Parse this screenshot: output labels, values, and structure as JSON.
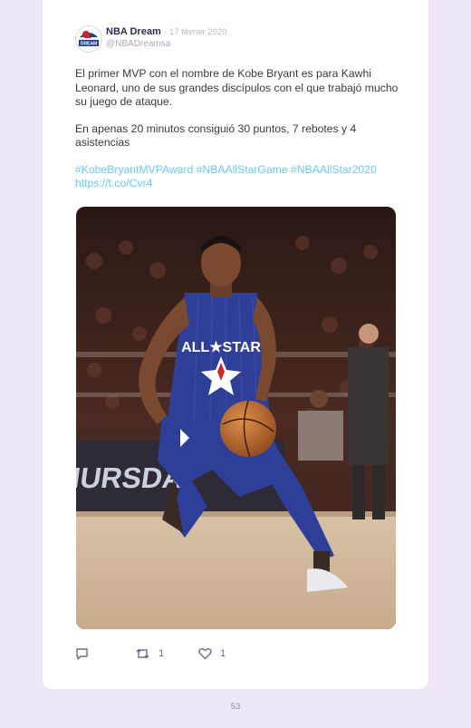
{
  "tweet": {
    "author_name": "NBA Dream",
    "separator": "·",
    "date": "17 février 2020",
    "handle": "@NBADreamsa",
    "paragraph_1": "El primer MVP con el nombre de Kobe Bryant es para Kawhi Leonard, uno de sus grandes discípulos con el que trabajó mucho su juego de ataque.",
    "paragraph_2": "En apenas 20 minutos consiguió 30 puntos, 7 rebotes y 4 asistencias",
    "hashtags": [
      "#KobeBryantMVPAward",
      "#NBAAllStarGame",
      "#NBAAllStar2020"
    ],
    "link": "https://t.co/Cvr4",
    "media": {
      "jersey_text": "ALL★STAR",
      "banner_text": "THURSDAY"
    },
    "avatar_text": "DREAM",
    "actions": {
      "reply_icon": "reply-icon",
      "retweet_icon": "retweet-icon",
      "retweet_count": "1",
      "like_icon": "heart-icon",
      "like_count": "1"
    }
  },
  "page_number": "53",
  "colors": {
    "background": "#efe6f8",
    "card": "#ffffff",
    "hashtag": "#6ec6ee",
    "text": "#3a3a3a"
  }
}
